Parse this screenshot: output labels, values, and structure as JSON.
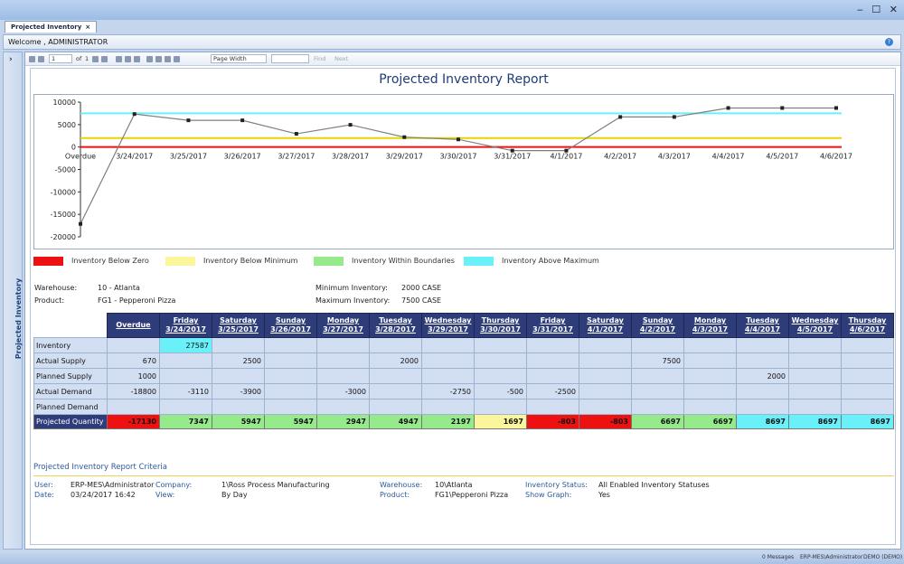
{
  "window": {
    "tab_label": "Projected Inventory",
    "tab_close": "×",
    "controls": "‒ ☐ ✕"
  },
  "welcome": "Welcome , ADMINISTRATOR",
  "side_panel": {
    "label": "Projected Inventory",
    "arrow": "›"
  },
  "toolbar": {
    "page": "1",
    "of": "of",
    "total": "1",
    "zoom": "Page Width",
    "find": "Find",
    "next": "Next"
  },
  "report": {
    "title": "Projected Inventory Report",
    "legend": [
      {
        "label": "Inventory Below Zero",
        "color": "#ee1111"
      },
      {
        "label": "Inventory Below Minimum",
        "color": "#fbf59b"
      },
      {
        "label": "Inventory Within Boundaries",
        "color": "#96ea8c"
      },
      {
        "label": "Inventory Above Maximum",
        "color": "#69f0f8"
      }
    ],
    "info": {
      "warehouse_label": "Warehouse:",
      "warehouse": "10 - Atlanta",
      "product_label": "Product:",
      "product": "FG1 - Pepperoni Pizza",
      "min_label": "Minimum Inventory:",
      "min": "2000 CASE",
      "max_label": "Maximum Inventory:",
      "max": "7500 CASE"
    },
    "columns": [
      {
        "day": "",
        "date": "Overdue"
      },
      {
        "day": "Friday",
        "date": "3/24/2017"
      },
      {
        "day": "Saturday",
        "date": "3/25/2017"
      },
      {
        "day": "Sunday",
        "date": "3/26/2017"
      },
      {
        "day": "Monday",
        "date": "3/27/2017"
      },
      {
        "day": "Tuesday",
        "date": "3/28/2017"
      },
      {
        "day": "Wednesday",
        "date": "3/29/2017"
      },
      {
        "day": "Thursday",
        "date": "3/30/2017"
      },
      {
        "day": "Friday",
        "date": "3/31/2017"
      },
      {
        "day": "Saturday",
        "date": "4/1/2017"
      },
      {
        "day": "Sunday",
        "date": "4/2/2017"
      },
      {
        "day": "Monday",
        "date": "4/3/2017"
      },
      {
        "day": "Tuesday",
        "date": "4/4/2017"
      },
      {
        "day": "Wednesday",
        "date": "4/5/2017"
      },
      {
        "day": "Thursday",
        "date": "4/6/2017"
      }
    ],
    "rows": [
      {
        "label": "Inventory",
        "cells": [
          "",
          "27587",
          "",
          "",
          "",
          "",
          "",
          "",
          "",
          "",
          "",
          "",
          "",
          "",
          ""
        ],
        "highlight": {
          "1": "#69f0f8"
        }
      },
      {
        "label": "Actual Supply",
        "cells": [
          "670",
          "",
          "2500",
          "",
          "",
          "2000",
          "",
          "",
          "",
          "",
          "7500",
          "",
          "",
          "",
          ""
        ]
      },
      {
        "label": "Planned Supply",
        "cells": [
          "1000",
          "",
          "",
          "",
          "",
          "",
          "",
          "",
          "",
          "",
          "",
          "",
          "2000",
          "",
          ""
        ]
      },
      {
        "label": "Actual Demand",
        "cells": [
          "-18800",
          "-3110",
          "-3900",
          "",
          "-3000",
          "",
          "-2750",
          "-500",
          "-2500",
          "",
          "",
          "",
          "",
          "",
          ""
        ]
      },
      {
        "label": "Planned Demand",
        "cells": [
          "",
          "",
          "",
          "",
          "",
          "",
          "",
          "",
          "",
          "",
          "",
          "",
          "",
          "",
          ""
        ]
      }
    ],
    "projected": {
      "label": "Projected Quantity",
      "values": [
        "-17130",
        "7347",
        "5947",
        "5947",
        "2947",
        "4947",
        "2197",
        "1697",
        "-803",
        "-803",
        "6697",
        "6697",
        "8697",
        "8697",
        "8697"
      ],
      "colors": [
        "#ee1111",
        "#96ea8c",
        "#96ea8c",
        "#96ea8c",
        "#96ea8c",
        "#96ea8c",
        "#96ea8c",
        "#fbf59b",
        "#ee1111",
        "#ee1111",
        "#96ea8c",
        "#96ea8c",
        "#69f0f8",
        "#69f0f8",
        "#69f0f8"
      ]
    },
    "criteria": {
      "title": "Projected Inventory Report Criteria",
      "user_label": "User:",
      "user": "ERP-MES\\Administrator",
      "date_label": "Date:",
      "date": "03/24/2017 16:42",
      "company_label": "Company:",
      "company": "1\\Ross Process Manufacturing",
      "view_label": "View:",
      "view": "By Day",
      "warehouse_label": "Warehouse:",
      "warehouse": "10\\Atlanta",
      "product_label": "Product:",
      "product": "FG1\\Pepperoni Pizza",
      "status_label": "Inventory Status:",
      "status": "All Enabled Inventory Statuses",
      "graph_label": "Show Graph:",
      "graph": "Yes"
    }
  },
  "statusbar": {
    "messages": "0 Messages",
    "user": "ERP-MES\\Administrator",
    "env": "DEMO (DEMO)"
  },
  "chart_data": {
    "type": "line",
    "x": [
      "Overdue",
      "3/24/2017",
      "3/25/2017",
      "3/26/2017",
      "3/27/2017",
      "3/28/2017",
      "3/29/2017",
      "3/30/2017",
      "3/31/2017",
      "4/1/2017",
      "4/2/2017",
      "4/3/2017",
      "4/4/2017",
      "4/5/2017",
      "4/6/2017"
    ],
    "series": [
      {
        "values": [
          -17130,
          7347,
          5947,
          5947,
          2947,
          4947,
          2197,
          1697,
          -803,
          -803,
          6697,
          6697,
          8697,
          8697,
          8697
        ],
        "color": "#7f7f7f"
      }
    ],
    "reference_lines": [
      {
        "value": 0,
        "color": "#ee1111"
      },
      {
        "value": 2000,
        "color": "#e6d600"
      },
      {
        "value": 7500,
        "color": "#69f0f8"
      }
    ],
    "yticks": [
      10000,
      5000,
      0,
      -5000,
      -10000,
      -15000,
      -20000
    ],
    "ylim": [
      -20000,
      10000
    ],
    "grid": false
  }
}
